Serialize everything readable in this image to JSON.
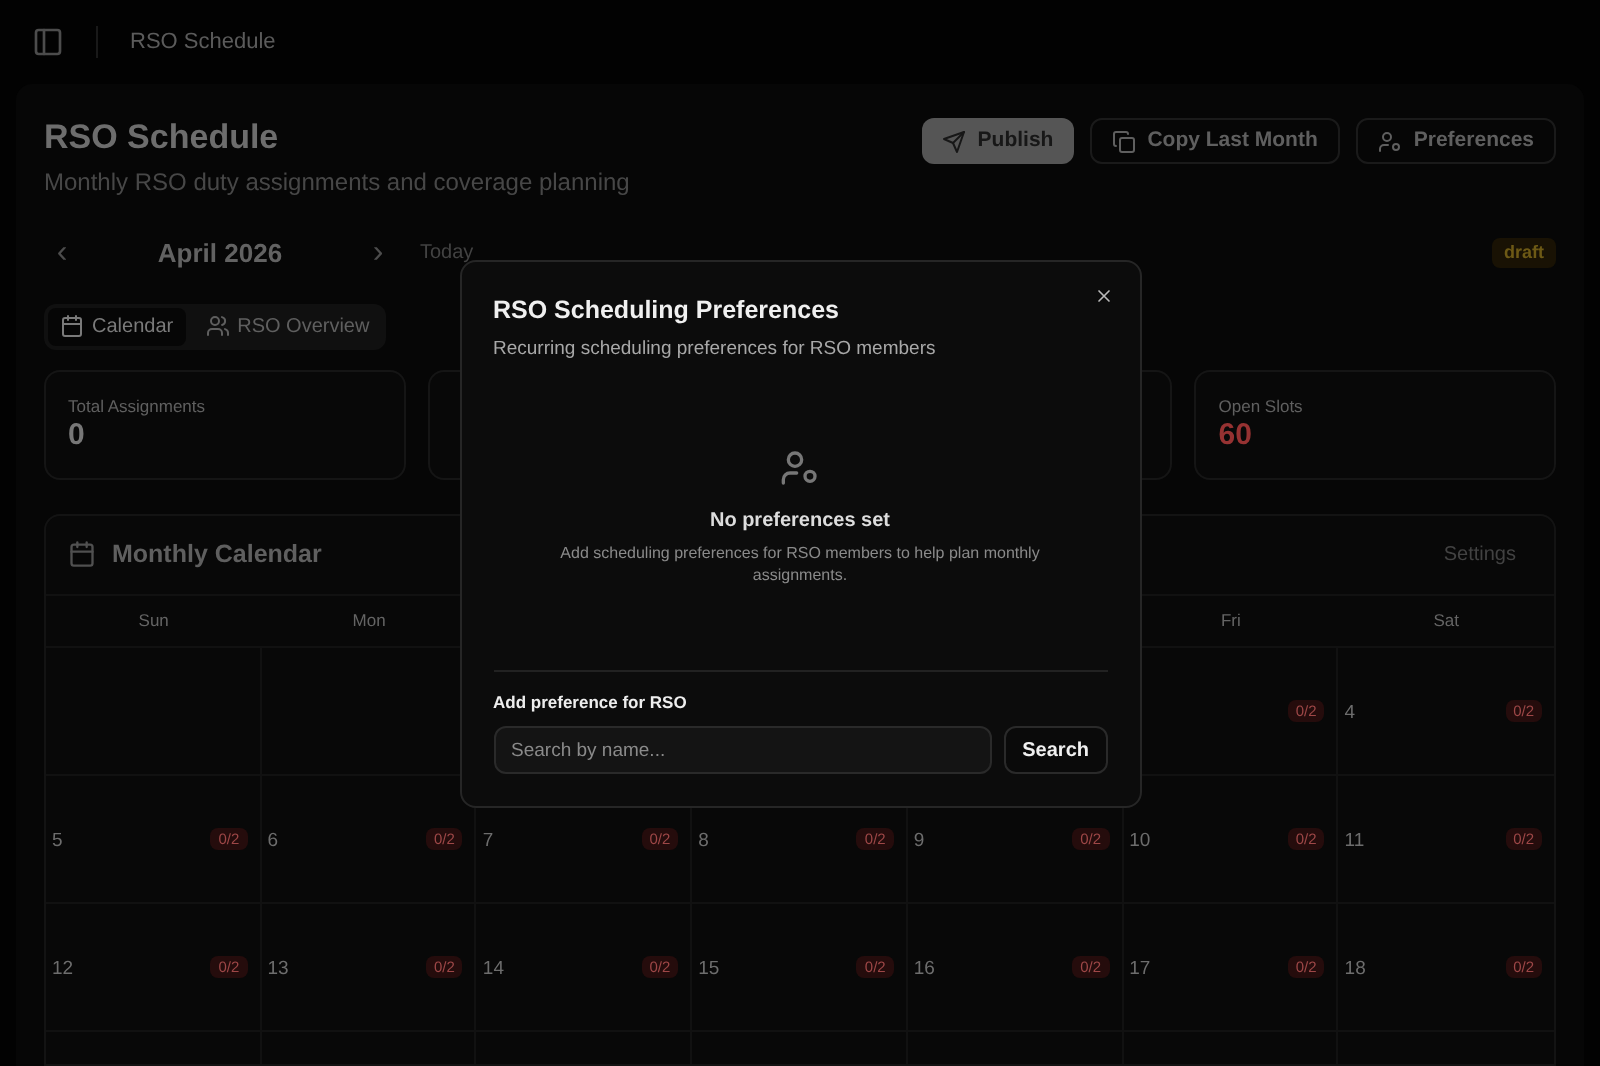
{
  "top_bar": {
    "breadcrumb": "RSO Schedule"
  },
  "header": {
    "title": "RSO Schedule",
    "subtitle": "Monthly RSO duty assignments and coverage planning",
    "buttons": [
      {
        "kind": "primary",
        "label": "Publish"
      },
      {
        "kind": "outline",
        "label": "Copy Last Month"
      },
      {
        "kind": "outline",
        "label": "Preferences"
      }
    ]
  },
  "month_nav": {
    "prev": "‹",
    "month": "April 2026",
    "next": "›",
    "today": "Today",
    "status_badge": "draft"
  },
  "view_tabs": [
    {
      "label": "Calendar",
      "selected": true
    },
    {
      "label": "RSO Overview",
      "selected": false
    }
  ],
  "stats": [
    {
      "kind": "stat",
      "label": "Total Assignments",
      "value": "0",
      "alert": false
    },
    {
      "kind": "blank"
    },
    {
      "kind": "blank"
    },
    {
      "kind": "stat",
      "label": "Open Slots",
      "value": "60",
      "alert": true
    }
  ],
  "calendar": {
    "title": "Monthly Calendar",
    "settings": "Settings",
    "weekdays": [
      {
        "kind": "label",
        "label": "Sun"
      },
      {
        "kind": "label",
        "label": "Mon"
      },
      {
        "kind": "blank"
      },
      {
        "kind": "blank"
      },
      {
        "kind": "blank"
      },
      {
        "kind": "label",
        "label": "Fri"
      },
      {
        "kind": "label",
        "label": "Sat"
      }
    ],
    "weeks": [
      [
        {
          "kind": "blank"
        },
        {
          "kind": "blank"
        },
        {
          "kind": "blank"
        },
        {
          "kind": "blank"
        },
        {
          "kind": "blank"
        },
        {
          "kind": "day",
          "badge": "0/2"
        },
        {
          "kind": "day",
          "day": "4",
          "badge": "0/2"
        }
      ],
      [
        {
          "kind": "day",
          "day": "5",
          "badge": "0/2"
        },
        {
          "kind": "day",
          "day": "6",
          "badge": "0/2"
        },
        {
          "kind": "day",
          "day": "7",
          "badge": "0/2"
        },
        {
          "kind": "day",
          "day": "8",
          "badge": "0/2"
        },
        {
          "kind": "day",
          "day": "9",
          "badge": "0/2"
        },
        {
          "kind": "day",
          "day": "10",
          "badge": "0/2"
        },
        {
          "kind": "day",
          "day": "11",
          "badge": "0/2"
        }
      ],
      [
        {
          "kind": "day",
          "day": "12",
          "badge": "0/2"
        },
        {
          "kind": "day",
          "day": "13",
          "badge": "0/2"
        },
        {
          "kind": "day",
          "day": "14",
          "badge": "0/2"
        },
        {
          "kind": "day",
          "day": "15",
          "badge": "0/2"
        },
        {
          "kind": "day",
          "day": "16",
          "badge": "0/2"
        },
        {
          "kind": "day",
          "day": "17",
          "badge": "0/2"
        },
        {
          "kind": "day",
          "day": "18",
          "badge": "0/2"
        }
      ],
      [
        {
          "kind": "blank"
        },
        {
          "kind": "blank"
        },
        {
          "kind": "blank"
        },
        {
          "kind": "blank"
        },
        {
          "kind": "blank"
        },
        {
          "kind": "blank"
        },
        {
          "kind": "blank"
        }
      ]
    ]
  },
  "dialog": {
    "title": "RSO Scheduling Preferences",
    "description": "Recurring scheduling preferences for RSO members",
    "empty_title": "No preferences set",
    "empty_text": "Add scheduling preferences for RSO members to help plan monthly assignments.",
    "add_label": "Add preference for RSO",
    "search": {
      "placeholder": "Search by name..."
    },
    "search_button": "Search"
  }
}
